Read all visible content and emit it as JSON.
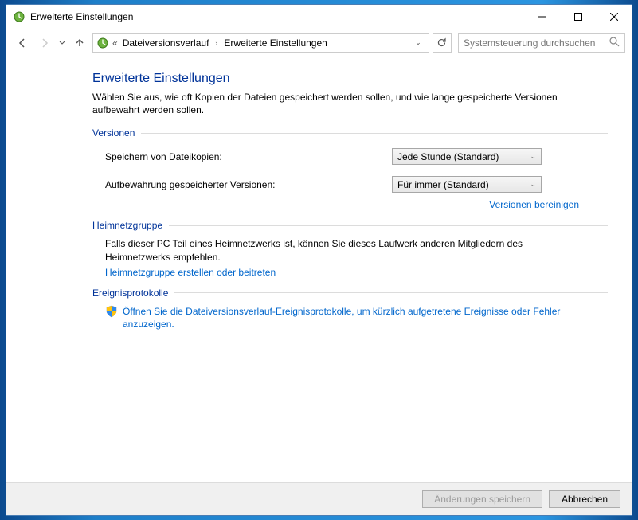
{
  "window": {
    "title": "Erweiterte Einstellungen"
  },
  "breadcrumb": {
    "prefix": "«",
    "items": [
      "Dateiversionsverlauf",
      "Erweiterte Einstellungen"
    ]
  },
  "search": {
    "placeholder": "Systemsteuerung durchsuchen"
  },
  "page": {
    "title": "Erweiterte Einstellungen",
    "desc": "Wählen Sie aus, wie oft Kopien der Dateien gespeichert werden sollen, und wie lange gespeicherte Versionen aufbewahrt werden sollen."
  },
  "sections": {
    "versions": {
      "label": "Versionen",
      "save_label": "Speichern von Dateikopien:",
      "save_value": "Jede Stunde (Standard)",
      "keep_label": "Aufbewahrung gespeicherter Versionen:",
      "keep_value": "Für immer (Standard)",
      "cleanup_link": "Versionen bereinigen"
    },
    "homegroup": {
      "label": "Heimnetzgruppe",
      "text": "Falls dieser PC Teil eines Heimnetzwerks ist, können Sie dieses Laufwerk anderen Mitgliedern des Heimnetzwerks empfehlen.",
      "link": "Heimnetzgruppe erstellen oder beitreten"
    },
    "events": {
      "label": "Ereignisprotokolle",
      "link": "Öffnen Sie die Dateiversionsverlauf-Ereignisprotokolle, um kürzlich aufgetretene Ereignisse oder Fehler anzuzeigen."
    }
  },
  "footer": {
    "save": "Änderungen speichern",
    "cancel": "Abbrechen"
  }
}
